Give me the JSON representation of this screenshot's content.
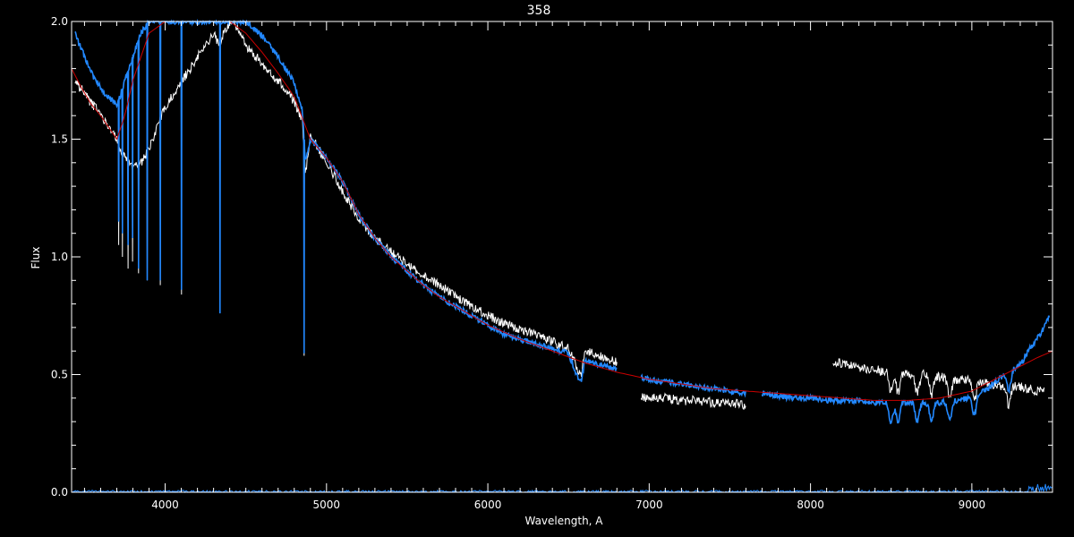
{
  "chart_data": {
    "type": "line",
    "title": "358",
    "xlabel": "Wavelength, A",
    "ylabel": "Flux",
    "xlim": [
      3420,
      9500
    ],
    "ylim": [
      0.0,
      2.0
    ],
    "x_ticks": [
      {
        "value": 4000,
        "label": "4000"
      },
      {
        "value": 5000,
        "label": "5000"
      },
      {
        "value": 6000,
        "label": "6000"
      },
      {
        "value": 7000,
        "label": "7000"
      },
      {
        "value": 8000,
        "label": "8000"
      },
      {
        "value": 9000,
        "label": "9000"
      }
    ],
    "y_ticks": [
      {
        "value": 0.0,
        "label": "0.0"
      },
      {
        "value": 0.5,
        "label": "0.5"
      },
      {
        "value": 1.0,
        "label": "1.0"
      },
      {
        "value": 1.5,
        "label": "1.5"
      },
      {
        "value": 2.0,
        "label": "2.0"
      }
    ],
    "grid": false,
    "legend": "none",
    "series": [
      {
        "key": "observed",
        "color": "#ffffff",
        "segments": [
          {
            "x": [
              3440,
              3470,
              3500,
              3530,
              3560,
              3600,
              3640,
              3680,
              3700,
              3720,
              3750,
              3800,
              3850,
              3900,
              3950,
              4000,
              4100,
              4200,
              4300,
              4330,
              4400,
              4450,
              4500,
              4600,
              4700,
              4800,
              4850,
              4870,
              4900,
              5000,
              5100,
              5200,
              5300,
              5400,
              5500,
              5600,
              5700,
              5800,
              5900,
              6000,
              6100,
              6200,
              6300,
              6400,
              6500,
              6560,
              6580,
              6600,
              6700,
              6800
            ],
            "y": [
              1.76,
              1.72,
              1.7,
              1.66,
              1.64,
              1.6,
              1.57,
              1.52,
              1.5,
              1.46,
              1.42,
              1.38,
              1.4,
              1.46,
              1.55,
              1.64,
              1.74,
              1.85,
              1.95,
              1.9,
              2.0,
              1.97,
              1.9,
              1.82,
              1.75,
              1.66,
              1.58,
              1.35,
              1.52,
              1.4,
              1.28,
              1.16,
              1.08,
              1.02,
              0.97,
              0.92,
              0.88,
              0.83,
              0.79,
              0.75,
              0.72,
              0.69,
              0.67,
              0.64,
              0.61,
              0.52,
              0.5,
              0.6,
              0.58,
              0.55
            ],
            "absorption": [
              {
                "x": 3712,
                "y": 1.05
              },
              {
                "x": 3735,
                "y": 1.0
              },
              {
                "x": 3770,
                "y": 0.95
              },
              {
                "x": 3798,
                "y": 0.98
              },
              {
                "x": 3835,
                "y": 0.93
              },
              {
                "x": 3889,
                "y": 0.9
              },
              {
                "x": 3970,
                "y": 0.88
              },
              {
                "x": 4101,
                "y": 0.84
              },
              {
                "x": 4340,
                "y": 0.8
              },
              {
                "x": 4861,
                "y": 0.58
              }
            ]
          },
          {
            "x": [
              6950,
              7000,
              7100,
              7200,
              7300,
              7400,
              7500,
              7600
            ],
            "y": [
              0.4,
              0.4,
              0.4,
              0.39,
              0.39,
              0.38,
              0.38,
              0.37
            ]
          },
          {
            "x": [
              8140,
              8200,
              8300,
              8400,
              8500,
              8600,
              8700,
              8800,
              8900,
              9000,
              9100,
              9200,
              9300,
              9400,
              9450
            ],
            "y": [
              0.55,
              0.55,
              0.53,
              0.52,
              0.51,
              0.5,
              0.5,
              0.49,
              0.48,
              0.48,
              0.46,
              0.45,
              0.45,
              0.43,
              0.44
            ],
            "dips": [
              8498,
              8542,
              8662,
              8750,
              8863,
              9015,
              9229
            ]
          }
        ]
      },
      {
        "key": "model",
        "color": "#2288ff",
        "segments": [
          {
            "x": [
              3440,
              3470,
              3500,
              3530,
              3560,
              3600,
              3640,
              3680,
              3700,
              3720,
              3750,
              3800,
              3850,
              3900,
              3950,
              4000,
              4100,
              4200,
              4300,
              4330,
              4400,
              4450,
              4500,
              4600,
              4700,
              4800,
              4850,
              4870,
              4900,
              5000,
              5100,
              5200,
              5300,
              5400,
              5500,
              5600,
              5700,
              5800,
              5900,
              6000,
              6100,
              6200,
              6300,
              6400,
              6500,
              6560,
              6580,
              6600,
              6700,
              6800
            ],
            "y": [
              1.95,
              1.9,
              1.85,
              1.8,
              1.76,
              1.72,
              1.68,
              1.66,
              1.65,
              1.68,
              1.75,
              1.85,
              1.95,
              2.0,
              2.0,
              2.0,
              2.0,
              2.0,
              2.0,
              2.0,
              2.0,
              2.0,
              2.0,
              1.94,
              1.85,
              1.74,
              1.62,
              1.4,
              1.5,
              1.42,
              1.32,
              1.18,
              1.08,
              1.0,
              0.94,
              0.88,
              0.83,
              0.79,
              0.75,
              0.71,
              0.67,
              0.65,
              0.63,
              0.61,
              0.59,
              0.48,
              0.47,
              0.56,
              0.54,
              0.52
            ],
            "absorption": [
              {
                "x": 3712,
                "y": 1.15
              },
              {
                "x": 3735,
                "y": 1.1
              },
              {
                "x": 3770,
                "y": 1.05
              },
              {
                "x": 3798,
                "y": 1.08
              },
              {
                "x": 3835,
                "y": 0.95
              },
              {
                "x": 3889,
                "y": 0.9
              },
              {
                "x": 3970,
                "y": 0.9
              },
              {
                "x": 4101,
                "y": 0.86
              },
              {
                "x": 4340,
                "y": 0.76
              },
              {
                "x": 4861,
                "y": 0.59
              }
            ]
          },
          {
            "x": [
              6950,
              7000,
              7100,
              7200,
              7300,
              7400,
              7500,
              7600
            ],
            "y": [
              0.49,
              0.48,
              0.47,
              0.46,
              0.45,
              0.44,
              0.43,
              0.42
            ]
          },
          {
            "x": [
              7700,
              7800,
              7900,
              8000,
              8100,
              8140
            ],
            "y": [
              0.42,
              0.41,
              0.4,
              0.4,
              0.39,
              0.39
            ]
          },
          {
            "x": [
              8140,
              8200,
              8300,
              8400,
              8500,
              8600,
              8700,
              8800,
              8900,
              9000,
              9100,
              9200,
              9300,
              9350,
              9400,
              9450,
              9480
            ],
            "y": [
              0.39,
              0.39,
              0.39,
              0.38,
              0.38,
              0.38,
              0.38,
              0.38,
              0.39,
              0.4,
              0.44,
              0.5,
              0.54,
              0.6,
              0.65,
              0.7,
              0.75
            ],
            "dips": [
              8498,
              8542,
              8662,
              8750,
              8863,
              9015,
              9229
            ]
          }
        ]
      },
      {
        "key": "continuum",
        "color": "#cc0000",
        "segments": [
          {
            "x": [
              3420,
              3480,
              3540,
              3600,
              3650,
              3700,
              3750,
              3800,
              3900,
              4000,
              4100,
              4200,
              4300,
              4400,
              4500,
              4600,
              4700,
              4800,
              4900,
              5000,
              5100,
              5200,
              5300,
              5400,
              5500,
              5600,
              5700,
              5800,
              5900,
              6000,
              6200,
              6400,
              6600,
              6800,
              7000,
              7200,
              7400,
              7600,
              7800,
              8000,
              8200,
              8400,
              8600,
              8800,
              9000,
              9200,
              9400,
              9500
            ],
            "y": [
              1.8,
              1.72,
              1.65,
              1.6,
              1.55,
              1.5,
              1.6,
              1.75,
              1.95,
              2.0,
              2.0,
              2.0,
              2.0,
              2.0,
              1.95,
              1.87,
              1.78,
              1.68,
              1.5,
              1.42,
              1.32,
              1.18,
              1.08,
              1.0,
              0.94,
              0.88,
              0.83,
              0.79,
              0.75,
              0.71,
              0.65,
              0.6,
              0.55,
              0.51,
              0.48,
              0.46,
              0.44,
              0.43,
              0.42,
              0.41,
              0.4,
              0.39,
              0.39,
              0.4,
              0.43,
              0.5,
              0.57,
              0.6
            ]
          }
        ]
      }
    ]
  }
}
